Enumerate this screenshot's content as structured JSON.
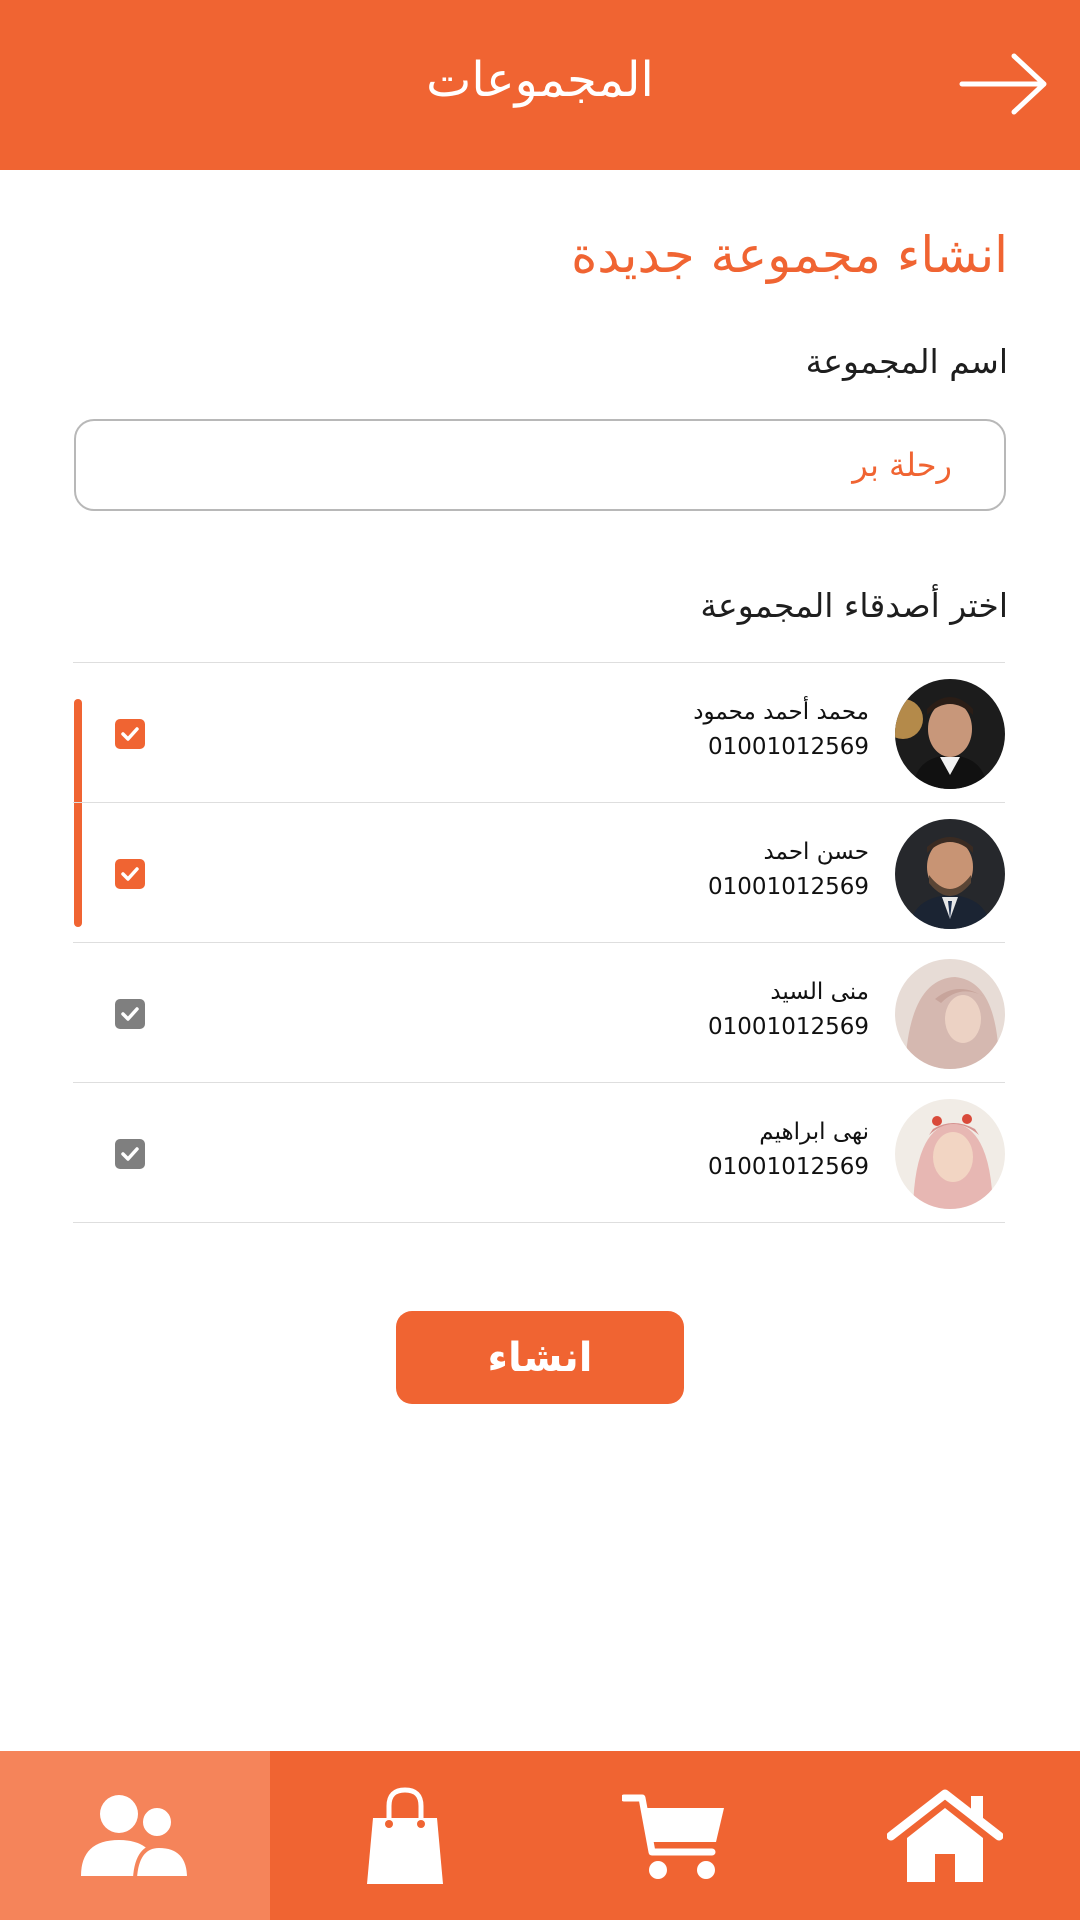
{
  "header": {
    "title": "المجموعات",
    "back_icon": "arrow-right-icon"
  },
  "form": {
    "heading": "انشاء مجموعة جديدة",
    "group_name_label": "اسم المجموعة",
    "group_name_value": "رحلة بر",
    "friends_label": "اختر أصدقاء المجموعة"
  },
  "friends": [
    {
      "name": "محمد أحمد محمود",
      "phone": "01001012569",
      "checked": true
    },
    {
      "name": "حسن احمد",
      "phone": "01001012569",
      "checked": true
    },
    {
      "name": "منى السيد",
      "phone": "01001012569",
      "checked": false
    },
    {
      "name": "نهى ابراهيم",
      "phone": "01001012569",
      "checked": false
    }
  ],
  "create_button": {
    "label": "انشاء"
  },
  "bottom_nav": [
    {
      "icon": "groups-icon",
      "active": true
    },
    {
      "icon": "shopping-bag-icon",
      "active": false
    },
    {
      "icon": "cart-icon",
      "active": false
    },
    {
      "icon": "home-icon",
      "active": false
    }
  ],
  "colors": {
    "accent": "#f06432",
    "accent_light": "#f5845a",
    "checkbox_checked": "#f06432",
    "checkbox_unchecked": "#7f7f7f"
  }
}
